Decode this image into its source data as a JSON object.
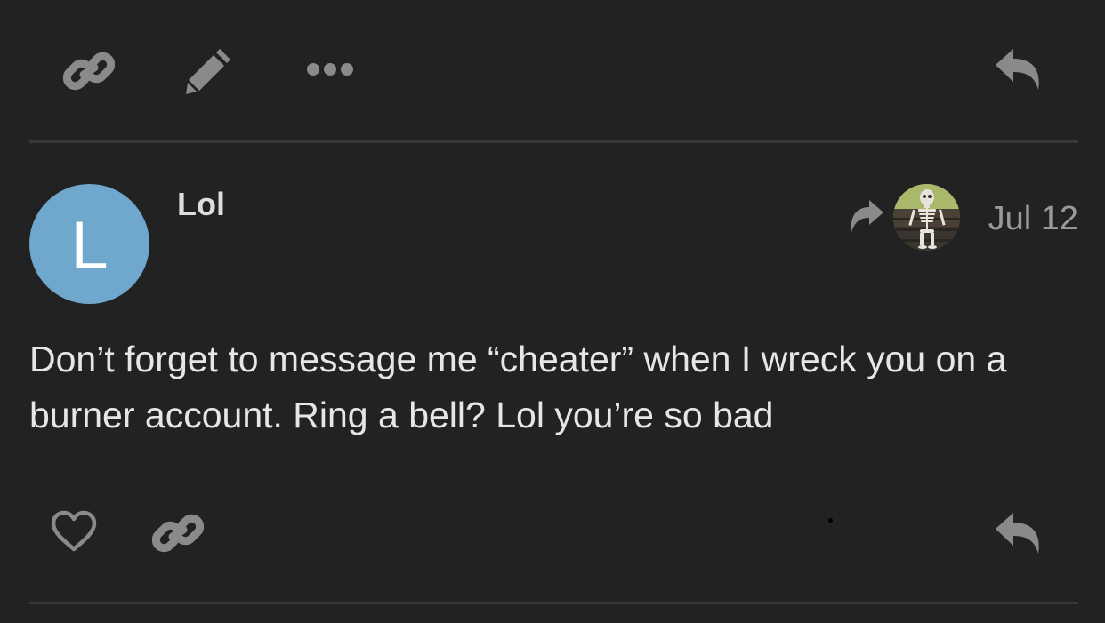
{
  "colors": {
    "background": "#222222",
    "text": "#e6e6e6",
    "muted_icon": "#8a8a8a",
    "divider": "#383838",
    "avatar_bg": "#6fa8cc"
  },
  "previous_post_actions": {
    "icons": [
      "link-icon",
      "pencil-icon",
      "ellipsis-icon",
      "reply-icon"
    ]
  },
  "post": {
    "author": {
      "avatar_letter": "L",
      "username": "Lol"
    },
    "reply_to": {
      "icon": "share-arrow-icon",
      "avatar": "skeleton-avatar"
    },
    "date": "Jul 12",
    "body": "Don’t forget to message me “cheater” when I wreck you on a burner account. Ring a bell? Lol you’re so bad",
    "actions": {
      "icons": [
        "heart-icon",
        "link-icon",
        "reply-icon"
      ]
    }
  }
}
